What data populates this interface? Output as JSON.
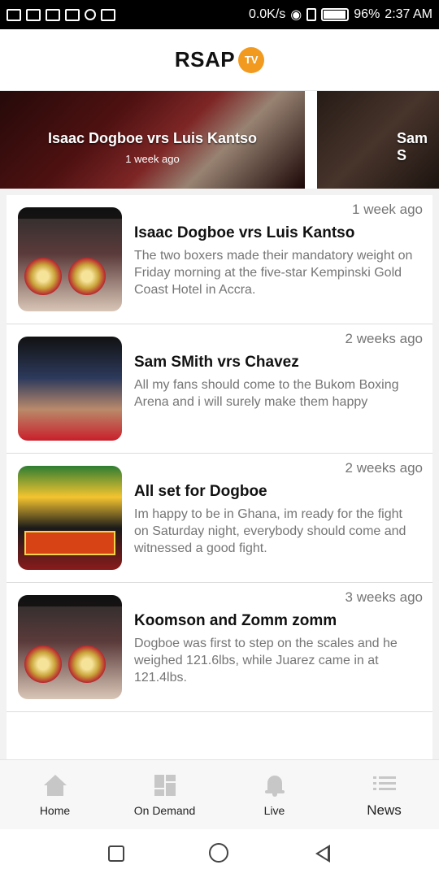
{
  "status_bar": {
    "network_speed": "0.0K/s",
    "battery_percent": "96%",
    "battery_level": 0.96,
    "time": "2:37 AM",
    "icons": [
      "facebook-icon",
      "gallery-icon",
      "shirt-icon",
      "mail-icon",
      "chat-icon",
      "youtube-icon",
      "wifi-icon",
      "sim-icon",
      "battery-icon"
    ]
  },
  "header": {
    "logo_text": "RSAP",
    "logo_badge": "TV",
    "badge_color": "#f29a1f"
  },
  "carousel": {
    "slides": [
      {
        "title": "Isaac Dogboe vrs Luis Kantso",
        "time": "1 week ago"
      },
      {
        "title": "Sam S"
      }
    ]
  },
  "feed": {
    "items": [
      {
        "time": "1 week ago",
        "title": "Isaac Dogboe vrs Luis Kantso",
        "description": "The two boxers made their mandatory weight on Friday morning at the five-star Kempinski Gold Coast Hotel in Accra."
      },
      {
        "time": "2 weeks ago",
        "title": "Sam SMith vrs Chavez",
        "description": "All my fans should come to the Bukom Boxing Arena and i will surely make them happy"
      },
      {
        "time": "2 weeks ago",
        "title": "All set for Dogboe",
        "description": "Im happy to be in Ghana, im ready for the fight on Saturday night, everybody should come and witnessed a good fight."
      },
      {
        "time": "3 weeks ago",
        "title": "Koomson and Zomm zomm",
        "description": "Dogboe was first to step on the scales and he weighed 121.6lbs, while Juarez came in at 121.4lbs."
      }
    ]
  },
  "bottom_nav": {
    "items": [
      {
        "label": "Home",
        "icon": "home-icon"
      },
      {
        "label": "On Demand",
        "icon": "grid-icon"
      },
      {
        "label": "Live",
        "icon": "bell-icon"
      },
      {
        "label": "News",
        "icon": "list-icon",
        "active": true
      }
    ]
  },
  "system_nav": {
    "buttons": [
      "recents-button",
      "home-button",
      "back-button"
    ]
  }
}
